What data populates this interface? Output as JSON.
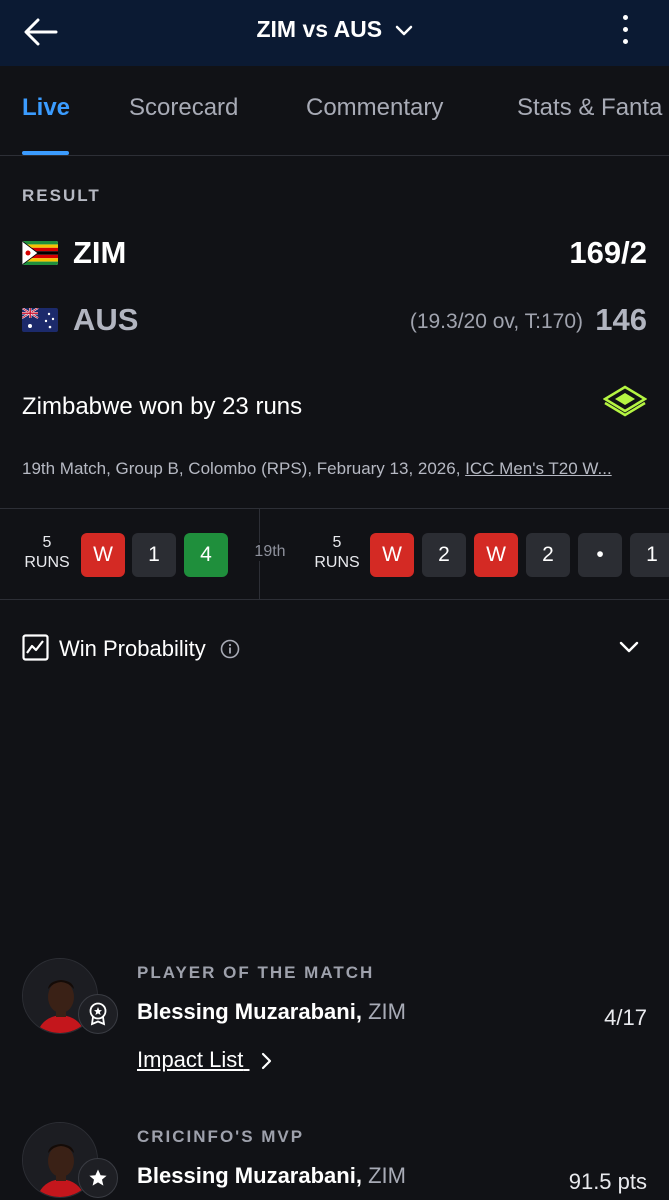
{
  "header": {
    "title": "ZIM vs AUS",
    "back_icon": "arrow-left-icon",
    "menu_icon": "more-vertical-icon"
  },
  "tabs": [
    {
      "label": "Live",
      "active": true
    },
    {
      "label": "Scorecard",
      "active": false
    },
    {
      "label": "Commentary",
      "active": false
    },
    {
      "label": "Stats & Fanta",
      "active": false
    }
  ],
  "result": {
    "label": "RESULT",
    "teams": [
      {
        "name": "ZIM",
        "overs": "",
        "score": "169/2"
      },
      {
        "name": "AUS",
        "overs": "(19.3/20 ov, T:170)",
        "score": "146"
      }
    ],
    "summary": "Zimbabwe won by 23 runs",
    "match_info": "19th Match, Group B, Colombo (RPS), February 13, 2026, ",
    "series_link": "ICC Men's T20 W..."
  },
  "overs_strip": {
    "prev_over": {
      "runs_number": "5",
      "runs_label": "RUNS",
      "balls": [
        "W",
        "1",
        "4"
      ]
    },
    "over_label": "19th",
    "current_over": {
      "runs_number": "5",
      "runs_label": "RUNS",
      "balls": [
        "W",
        "2",
        "W",
        "2",
        "•",
        "1"
      ]
    }
  },
  "win_probability": {
    "label": "Win Probability"
  },
  "awards": [
    {
      "label": "PLAYER OF THE MATCH",
      "player": "Blessing Muzarabani,",
      "team": "ZIM",
      "stat": "4/17",
      "link": "Impact List"
    },
    {
      "label": "CRICINFO'S MVP",
      "player": "Blessing Muzarabani,",
      "team": "ZIM",
      "stat": "91.5 pts"
    }
  ],
  "colors": {
    "accent": "#3b9cff",
    "wicket": "#d42a24",
    "boundary": "#1f8f3c",
    "header_bg": "#0b1a33",
    "page_bg": "#111216"
  }
}
